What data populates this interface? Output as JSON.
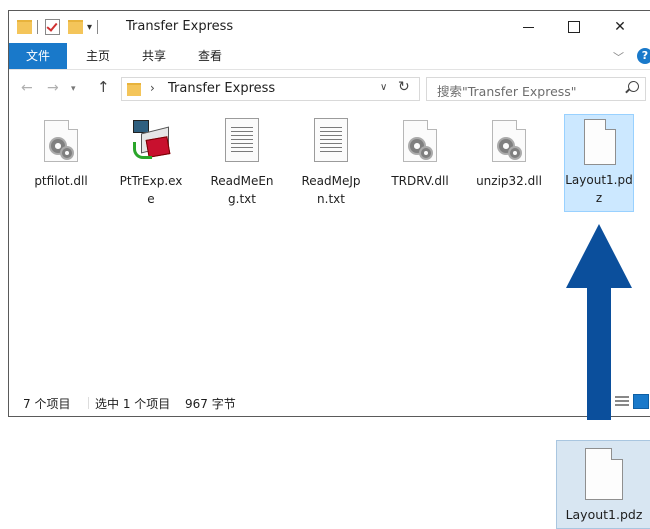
{
  "window": {
    "title": "Transfer Express",
    "controls": {
      "minimize": "",
      "maximize": "",
      "close": "✕"
    }
  },
  "ribbon": {
    "tabs": [
      "文件",
      "主页",
      "共享",
      "查看"
    ],
    "active_tab": "文件",
    "accent_color": "#1979ca"
  },
  "address": {
    "path": "Transfer Express",
    "separator": "›"
  },
  "search": {
    "placeholder": "搜索\"Transfer Express\""
  },
  "files": [
    {
      "name": "ptfilot.dll",
      "icon": "dll-gear-icon",
      "selected": false
    },
    {
      "name": "PtTrExp.exe",
      "icon": "exe-app-icon",
      "selected": false
    },
    {
      "name": "ReadMeEng.txt",
      "icon": "text-document-icon",
      "selected": false
    },
    {
      "name": "ReadMeJpn.txt",
      "icon": "text-document-icon",
      "selected": false
    },
    {
      "name": "TRDRV.dll",
      "icon": "dll-gear-icon",
      "selected": false
    },
    {
      "name": "unzip32.dll",
      "icon": "dll-gear-icon",
      "selected": false
    },
    {
      "name": "Layout1.pdz",
      "icon": "blank-document-icon",
      "selected": true
    }
  ],
  "status": {
    "item_count": "7 个项目",
    "selection": "选中 1 个项目",
    "size": "967 字节"
  },
  "desktop_file": {
    "name": "Layout1.pdz",
    "icon": "blank-document-icon"
  },
  "arrow": {
    "color": "#0b4f9c",
    "direction": "up"
  }
}
